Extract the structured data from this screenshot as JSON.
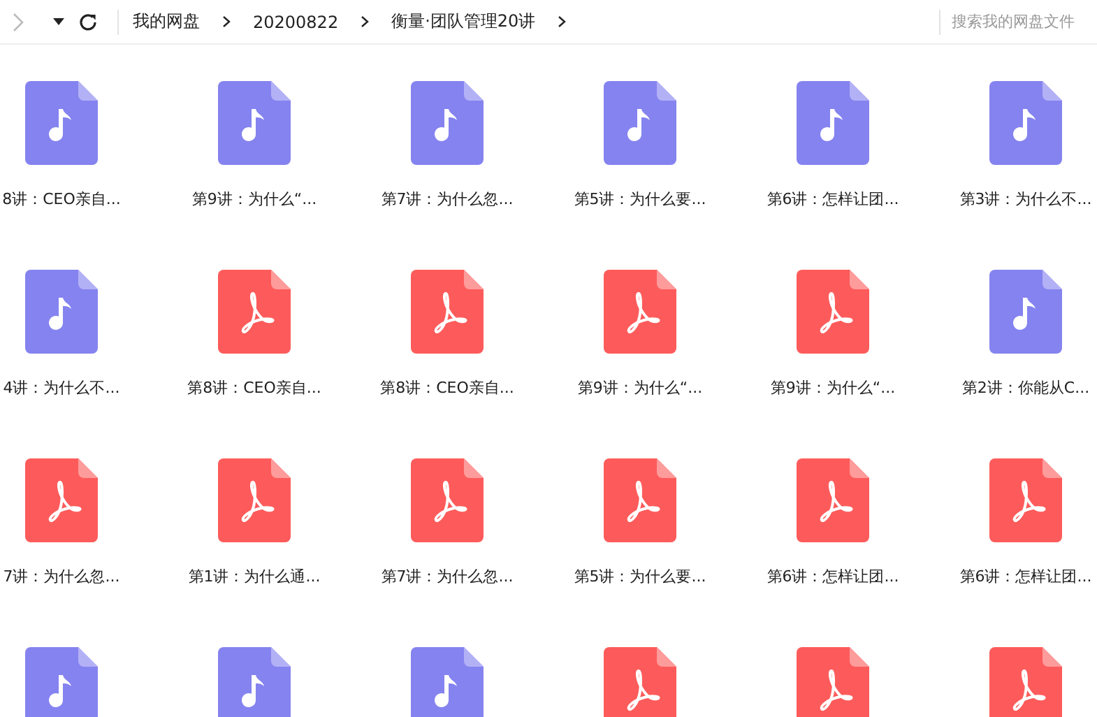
{
  "toolbar": {
    "forward_disabled": true,
    "breadcrumbs": [
      "我的网盘",
      "20200822",
      "衡量·团队管理20讲"
    ],
    "search": {
      "placeholder": "搜索我的网盘文件"
    }
  },
  "files": [
    {
      "kind": "audio",
      "name": "8讲：CEO亲自..."
    },
    {
      "kind": "audio",
      "name": "第9讲：为什么“..."
    },
    {
      "kind": "audio",
      "name": "第7讲：为什么忽..."
    },
    {
      "kind": "audio",
      "name": "第5讲：为什么要..."
    },
    {
      "kind": "audio",
      "name": "第6讲：怎样让团..."
    },
    {
      "kind": "audio",
      "name": "第3讲：为什么不..."
    },
    {
      "kind": "audio",
      "name": "4讲：为什么不..."
    },
    {
      "kind": "pdf",
      "name": "第8讲：CEO亲自..."
    },
    {
      "kind": "pdf",
      "name": "第8讲：CEO亲自..."
    },
    {
      "kind": "pdf",
      "name": "第9讲：为什么“..."
    },
    {
      "kind": "pdf",
      "name": "第9讲：为什么“..."
    },
    {
      "kind": "audio",
      "name": "第2讲：你能从C..."
    },
    {
      "kind": "pdf",
      "name": "7讲：为什么忽..."
    },
    {
      "kind": "pdf",
      "name": "第1讲：为什么通..."
    },
    {
      "kind": "pdf",
      "name": "第7讲：为什么忽..."
    },
    {
      "kind": "pdf",
      "name": "第5讲：为什么要..."
    },
    {
      "kind": "pdf",
      "name": "第6讲：怎样让团..."
    },
    {
      "kind": "pdf",
      "name": "第6讲：怎样让团..."
    },
    {
      "kind": "audio"
    },
    {
      "kind": "audio"
    },
    {
      "kind": "audio"
    },
    {
      "kind": "pdf"
    },
    {
      "kind": "pdf"
    },
    {
      "kind": "pdf"
    }
  ]
}
